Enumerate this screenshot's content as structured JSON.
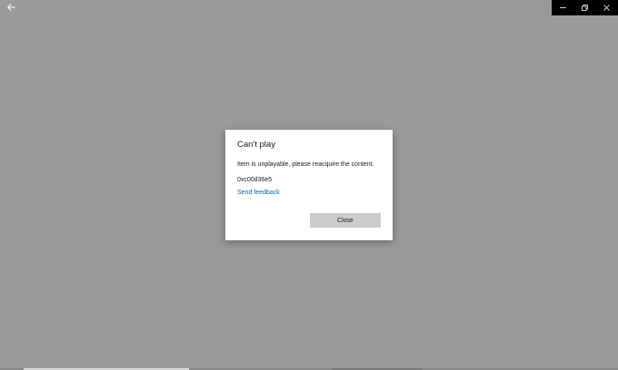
{
  "dialog": {
    "title": "Can't play",
    "message": "Item is unplayable, please reacquire the content.",
    "error_code": "0xc00d36e5",
    "feedback_link": "Send feedback",
    "close_label": "Close"
  },
  "icons": {
    "back": "back-arrow-icon",
    "minimize": "minimize-icon",
    "restore": "restore-icon",
    "close": "close-icon"
  },
  "colors": {
    "background": "#9a9a9a",
    "title_bar_controls": "#000000",
    "dialog": "#ffffff",
    "link": "#0063b1",
    "button": "#cccccc"
  }
}
